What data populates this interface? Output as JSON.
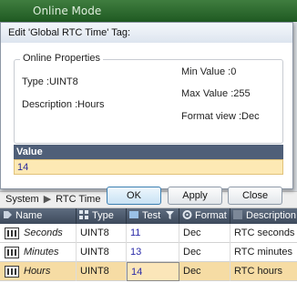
{
  "app": {
    "title": "Online Mode"
  },
  "dialog": {
    "title": "Edit 'Global RTC Time' Tag:",
    "group_title": "Online Properties",
    "type": "Type :UINT8",
    "description": "Description :Hours",
    "min_value": "Min Value :0",
    "max_value": "Max Value :255",
    "format_view": "Format view :Dec",
    "value_header": "Value",
    "value": "14",
    "buttons": {
      "ok": "OK",
      "apply": "Apply",
      "close": "Close"
    }
  },
  "breadcrumb": {
    "items": [
      "System",
      "RTC Time"
    ],
    "separator": "▶"
  },
  "table": {
    "columns": [
      "Name",
      "Type",
      "Test",
      "Format",
      "Description"
    ],
    "rows": [
      {
        "name": "Seconds",
        "type": "UINT8",
        "test": "11",
        "format": "Dec",
        "description": "RTC seconds"
      },
      {
        "name": "Minutes",
        "type": "UINT8",
        "test": "13",
        "format": "Dec",
        "description": "RTC minutes"
      },
      {
        "name": "Hours",
        "type": "UINT8",
        "test": "14",
        "format": "Dec",
        "description": "RTC hours"
      }
    ],
    "selected_row": 2
  },
  "colors": {
    "title_bar": "#2e6b30",
    "table_header": "#4a586b",
    "selected_row": "#f6dca4",
    "value_header": "#4f5f78",
    "value_field": "#fde9b4"
  },
  "icons": {
    "name_column": "tag-icon",
    "type_column": "type-grid-icon",
    "test_column": "test-icon",
    "test_filter": "filter-icon",
    "format_column": "gear-icon",
    "description_column": "description-icon",
    "row": "tag-icon"
  }
}
